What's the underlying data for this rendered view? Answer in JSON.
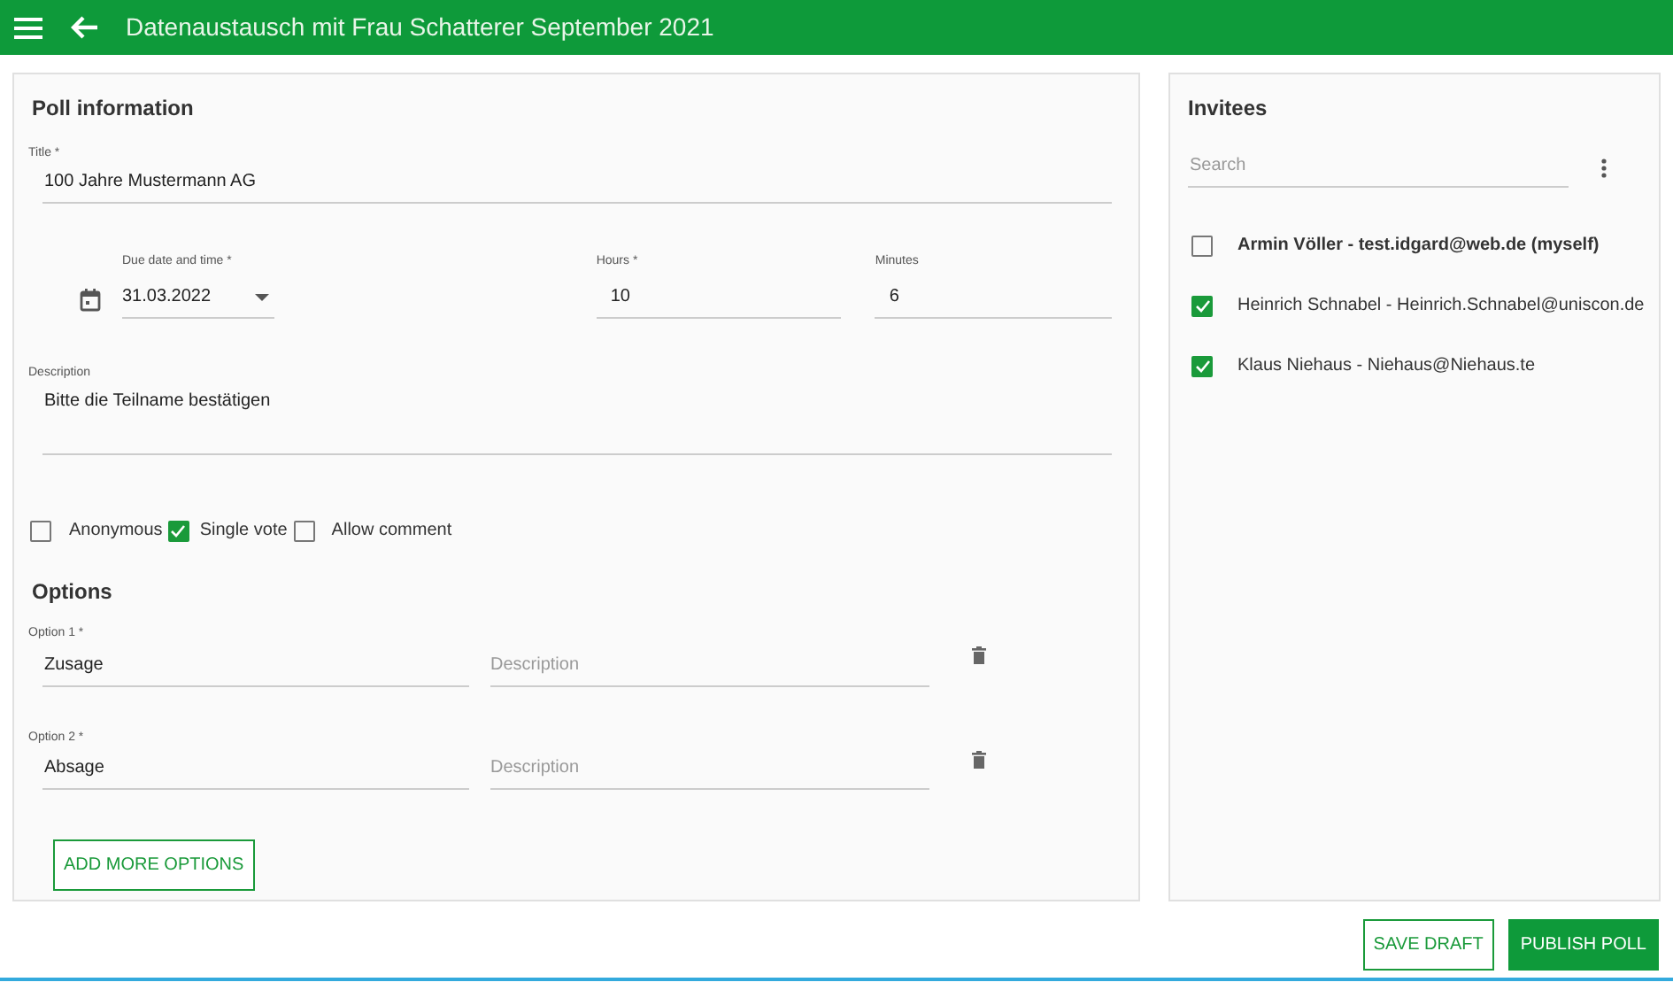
{
  "app_bar": {
    "title": "Datenaustausch mit Frau Schatterer September 2021"
  },
  "poll": {
    "heading": "Poll information",
    "title_field": {
      "label": "Title *",
      "value": "100 Jahre Mustermann AG"
    },
    "due_date": {
      "label": "Due date and time *",
      "value": "31.03.2022"
    },
    "hours": {
      "label": "Hours *",
      "value": "10"
    },
    "minutes": {
      "label": "Minutes",
      "value": "6"
    },
    "description": {
      "label": "Description",
      "value": "Bitte die Teilname bestätigen"
    },
    "settings": [
      {
        "label": "Anonymous",
        "checked": false
      },
      {
        "label": "Single vote",
        "checked": true
      },
      {
        "label": "Allow comment",
        "checked": false
      }
    ],
    "options_heading": "Options",
    "options": [
      {
        "label": "Option 1 *",
        "value": "Zusage",
        "description_placeholder": "Description"
      },
      {
        "label": "Option 2 *",
        "value": "Absage",
        "description_placeholder": "Description"
      }
    ],
    "add_button": "ADD MORE OPTIONS"
  },
  "invitees": {
    "heading": "Invitees",
    "search_placeholder": "Search",
    "people": [
      {
        "text": "Armin Völler - test.idgard@web.de (myself)",
        "bold": true,
        "checked": false
      },
      {
        "text": "Heinrich Schnabel - Heinrich.Schnabel@uniscon.de",
        "bold": false,
        "checked": true
      },
      {
        "text": "Klaus Niehaus - Niehaus@Niehaus.te",
        "bold": false,
        "checked": true
      }
    ]
  },
  "actions": [
    {
      "label": "SAVE DRAFT",
      "kind": "outline"
    },
    {
      "label": "PUBLISH POLL",
      "kind": "filled"
    }
  ]
}
